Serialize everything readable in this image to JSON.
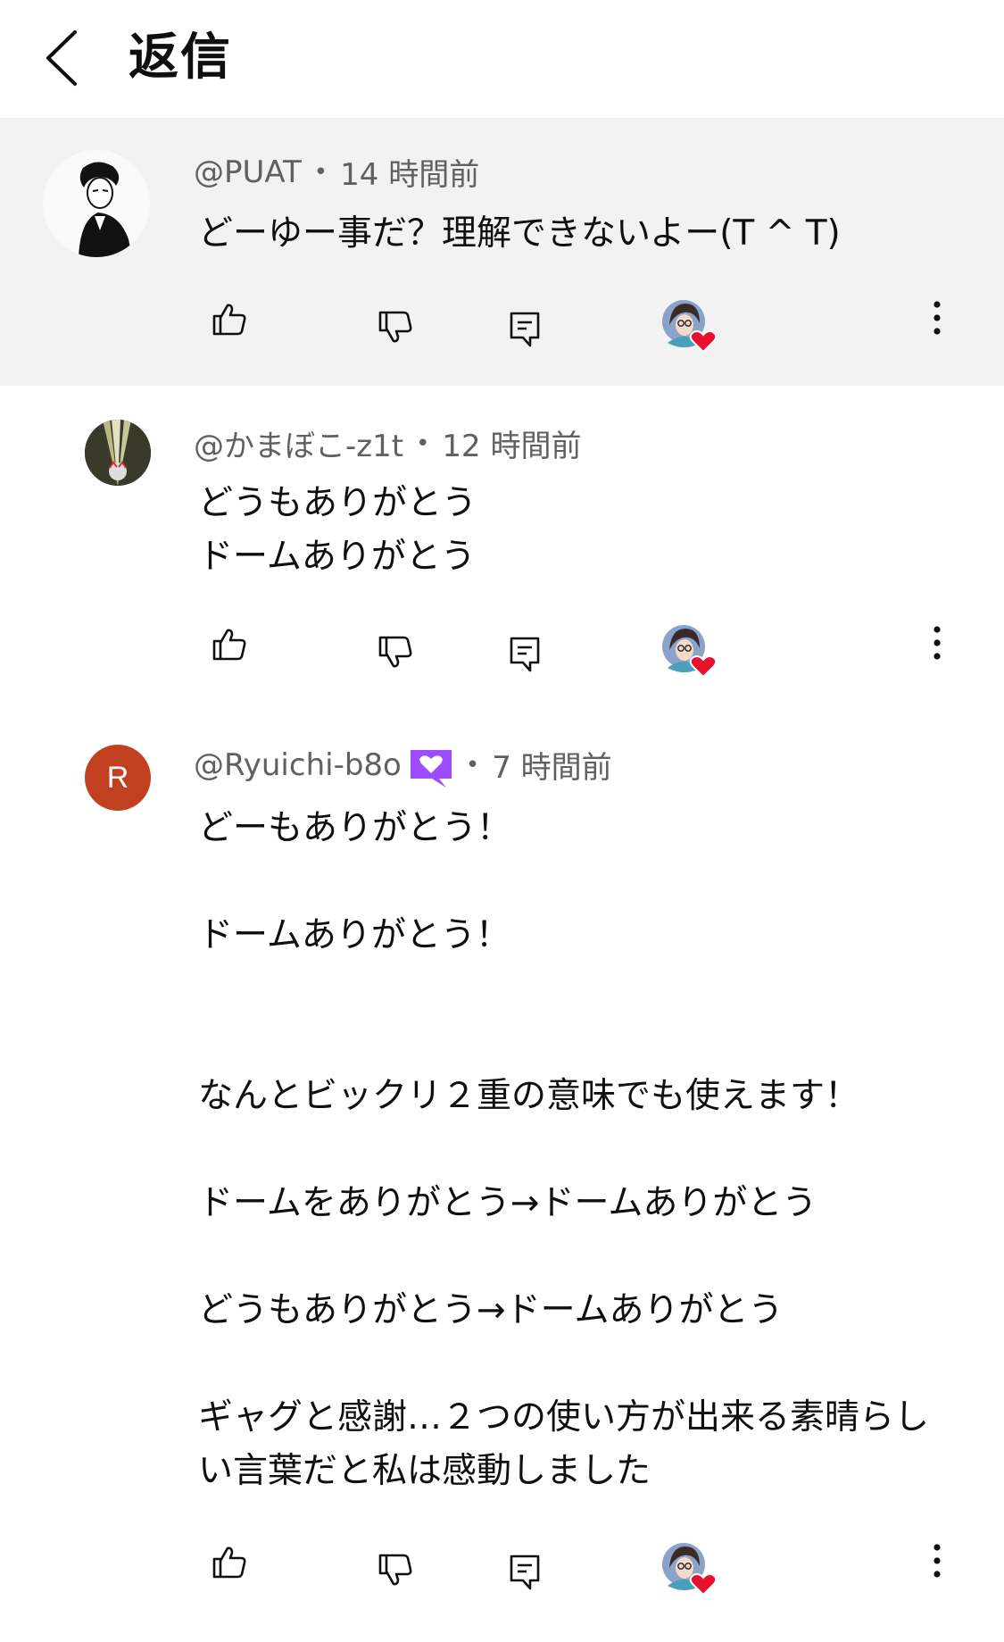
{
  "header": {
    "title": "返信"
  },
  "comments": [
    {
      "handle": "@PUAT",
      "time": "14 時間前",
      "body": "どーゆー事だ？理解できないよー(T ^ T)"
    },
    {
      "handle": "@かまぼこ-z1t",
      "time": "12 時間前",
      "body": "どうもありがとう\nドームありがとう"
    },
    {
      "handle": "@Ryuichi-b8o",
      "avatar_letter": "R",
      "time": "7 時間前",
      "body": "どーもありがとう！\n\nドームありがとう！\n\n\nなんとビックリ２重の意味でも使えます！\n\nドームをありがとう→ドームありがとう\n\nどうもありがとう→ドームありがとう\n\nギャグと感謝…２つの使い方が出来る素晴らしい言葉だと私は感動しました"
    }
  ],
  "colors": {
    "avatar_r": "#c1401f",
    "badge": "#9b4dff",
    "heart": "#e8112d",
    "highlight_bg": "#f2f2f2"
  },
  "icons": [
    "chevron-left-icon",
    "thumb-up-icon",
    "thumb-down-icon",
    "reply-icon",
    "creator-heart-icon",
    "more-vert-icon",
    "member-badge-icon"
  ]
}
